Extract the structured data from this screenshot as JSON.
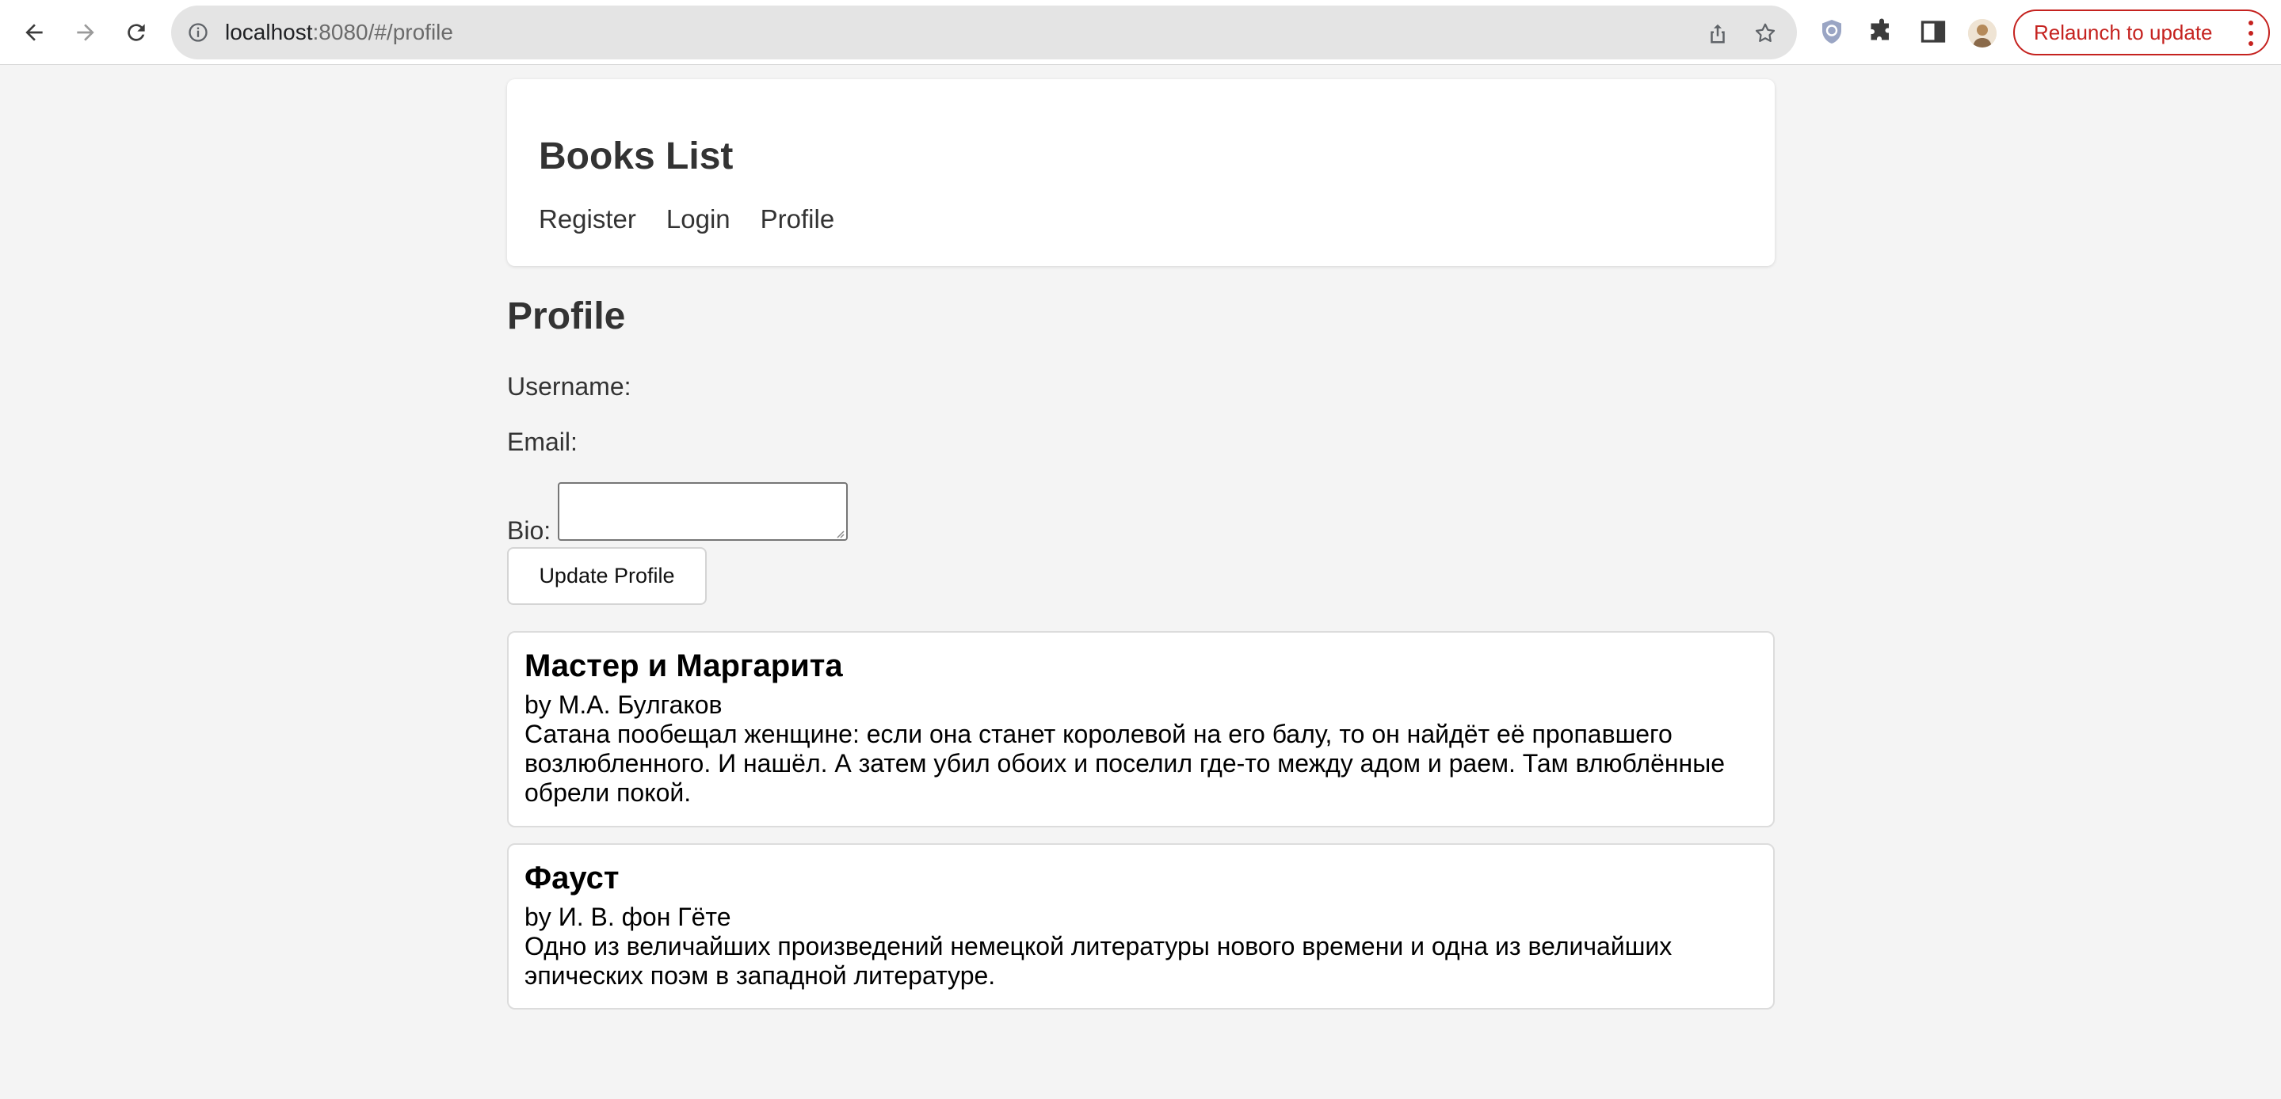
{
  "browser": {
    "url_host": "localhost",
    "url_rest": ":8080/#/profile",
    "relaunch_label": "Relaunch to update"
  },
  "header": {
    "title": "Books List",
    "nav": [
      {
        "label": "Register"
      },
      {
        "label": "Login"
      },
      {
        "label": "Profile"
      }
    ]
  },
  "profile": {
    "title": "Profile",
    "username_label": "Username:",
    "email_label": "Email:",
    "bio_label": "Bio:",
    "bio_value": "",
    "update_label": "Update Profile"
  },
  "books": [
    {
      "title": "Мастер и Маргарита",
      "author": "by М.А. Булгаков",
      "description": "Сатана пообещал женщине: если она станет королевой на его балу, то он найдёт её пропавшего возлюбленного. И нашёл. А затем убил обоих и поселил где-то между адом и раем. Там влюблённые обрели покой."
    },
    {
      "title": "Фауст",
      "author": "by И. В. фон Гёте",
      "description": "Одно из величайших произведений немецкой литературы нового времени и одна из величайших эпических поэм в западной литературе."
    }
  ],
  "colors": {
    "page_background": "#f4f4f4",
    "relaunch_accent": "#c5221f"
  }
}
